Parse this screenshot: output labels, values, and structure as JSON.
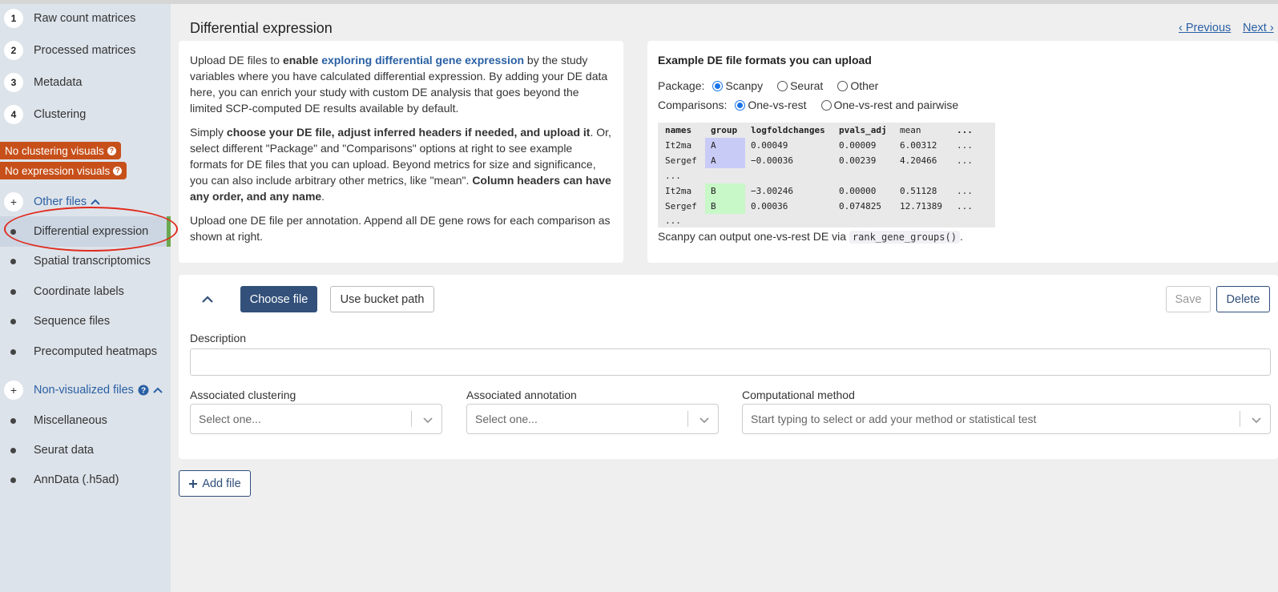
{
  "sidebar": {
    "steps": [
      {
        "num": "1",
        "label": "Raw count matrices"
      },
      {
        "num": "2",
        "label": "Processed matrices"
      },
      {
        "num": "3",
        "label": "Metadata"
      },
      {
        "num": "4",
        "label": "Clustering"
      }
    ],
    "badges": [
      "No clustering visuals",
      "No expression visuals"
    ],
    "other_files": {
      "label": "Other files",
      "items": [
        "Differential expression",
        "Spatial transcriptomics",
        "Coordinate labels",
        "Sequence files",
        "Precomputed heatmaps"
      ]
    },
    "non_visualized": {
      "label": "Non-visualized files",
      "items": [
        "Miscellaneous",
        "Seurat data",
        "AnnData (.h5ad)"
      ]
    }
  },
  "header": {
    "title": "Differential expression",
    "previous": "Previous",
    "next": "Next"
  },
  "intro": {
    "p1_a": "Upload DE files to ",
    "p1_link": "exploring differential gene expression",
    "p1_a_bold": "enable",
    "p1_b": " by the study variables where you have calculated differential expression. By adding your DE data here, you can enrich your study with custom DE analysis that goes beyond the limited SCP-computed DE results available by default.",
    "p2_a": "Simply ",
    "p2_bold": "choose your DE file, adjust inferred headers if needed, and upload it",
    "p2_b": ". Or, select different \"Package\" and \"Comparisons\" options at right to see example formats for DE files that you can upload. Beyond metrics for size and significance, you can also include arbitrary other metrics, like \"mean\". ",
    "p2_bold2": "Column headers can have any order, and any name",
    "p2_c": ".",
    "p3": "Upload one DE file per annotation. Append all DE gene rows for each comparison as shown at right."
  },
  "example": {
    "title": "Example DE file formats you can upload",
    "package_label": "Package:",
    "packages": [
      "Scanpy",
      "Seurat",
      "Other"
    ],
    "comparisons_label": "Comparisons:",
    "comparisons": [
      "One-vs-rest",
      "One-vs-rest and pairwise"
    ],
    "table": {
      "headers": [
        "names",
        "group",
        "logfoldchanges",
        "pvals_adj",
        "mean",
        "..."
      ],
      "rows": [
        [
          "It2ma",
          "A",
          "0.00049",
          "0.00009",
          "6.00312",
          "..."
        ],
        [
          "Sergef",
          "A",
          "−0.00036",
          "0.00239",
          "4.20466",
          "..."
        ],
        [
          "...",
          "",
          "",
          "",
          "",
          ""
        ],
        [
          "It2ma",
          "B",
          "−3.00246",
          "0.00000",
          "0.51128",
          "..."
        ],
        [
          "Sergef",
          "B",
          "0.00036",
          "0.074825",
          "12.71389",
          "..."
        ],
        [
          "...",
          "",
          "",
          "",
          "",
          ""
        ]
      ]
    },
    "note_prefix": "Scanpy can output one-vs-rest DE via ",
    "note_code": "rank_gene_groups()",
    "note_suffix": "."
  },
  "form": {
    "choose_file": "Choose file",
    "bucket_path": "Use bucket path",
    "save": "Save",
    "delete": "Delete",
    "description_label": "Description",
    "description_value": "",
    "clustering_label": "Associated clustering",
    "clustering_placeholder": "Select one...",
    "annotation_label": "Associated annotation",
    "annotation_placeholder": "Select one...",
    "method_label": "Computational method",
    "method_placeholder": "Start typing to select or add your method or statistical test"
  },
  "add_file": "Add file",
  "colors": {
    "accent": "#32507a",
    "link": "#2a60a4",
    "badge": "#c7501a",
    "active_bar": "#6aa84f",
    "highlight": "#e02b1e"
  }
}
